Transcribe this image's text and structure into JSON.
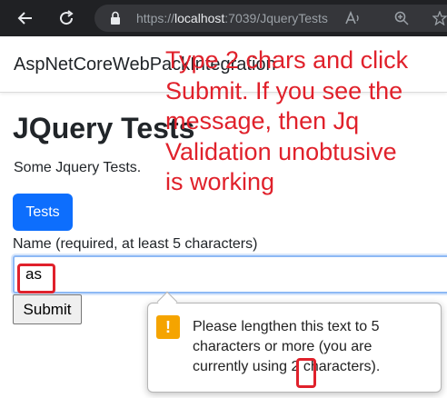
{
  "browser": {
    "url_prefix": "https://",
    "url_host": "localhost",
    "url_rest": ":7039/JqueryTests"
  },
  "navbar": {
    "brand": "AspNetCoreWebPackIntegration"
  },
  "main": {
    "title": "JQuery Tests",
    "lead": "Some Jquery Tests.",
    "tests_button": "Tests",
    "field_label": "Name (required, at least 5 characters)",
    "field_value": "as",
    "submit_button": "Submit"
  },
  "tooltip": {
    "icon_glyph": "!",
    "line1": "Please lengthen this text to 5",
    "line2": "characters or more (you are",
    "line3_pre": "currently using ",
    "line3_count": "2",
    "line3_post": " characters)."
  },
  "annotation": {
    "lines": [
      "Type 2 chars and click",
      "Submit. If you see the",
      "message, then Jq",
      "Validation unobtusive",
      "is working"
    ],
    "color": "#e0212b"
  },
  "colors": {
    "primary": "#0d6efd",
    "warning": "#f5a400",
    "chrome": "#202124"
  }
}
